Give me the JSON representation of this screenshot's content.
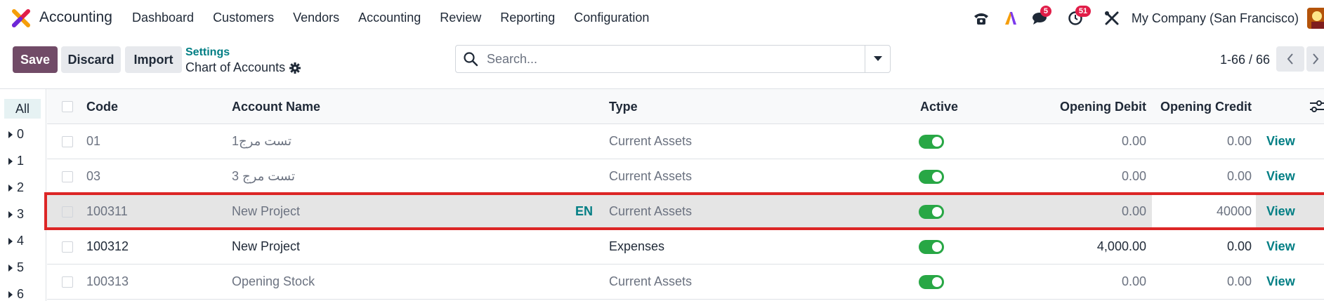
{
  "app": {
    "name": "Accounting",
    "logo_icon": "odoo-accounting-logo-icon"
  },
  "nav": {
    "items": [
      "Dashboard",
      "Customers",
      "Vendors",
      "Accounting",
      "Review",
      "Reporting",
      "Configuration"
    ]
  },
  "systray": {
    "voip_icon": "phone-icon",
    "ai_icon": "ai-icon",
    "messages_icon": "chat-icon",
    "messages_count": "5",
    "activities_icon": "clock-icon",
    "activities_count": "51",
    "debug_icon": "tools-icon",
    "company": "My Company (San Francisco)"
  },
  "control_panel": {
    "save_label": "Save",
    "discard_label": "Discard",
    "import_label": "Import",
    "breadcrumb_parent": "Settings",
    "page_title": "Chart of Accounts",
    "search_placeholder": "Search...",
    "pager_value": "1-66 / 66"
  },
  "side_panel": {
    "all_label": "All",
    "groups": [
      "0",
      "1",
      "2",
      "3",
      "4",
      "5",
      "6"
    ]
  },
  "table": {
    "columns": {
      "code": "Code",
      "name": "Account Name",
      "type": "Type",
      "active": "Active",
      "debit": "Opening Debit",
      "credit": "Opening Credit"
    },
    "rows": [
      {
        "code": "01",
        "name": "تست مرج1",
        "lang": "",
        "type": "Current Assets",
        "active": true,
        "debit": "0.00",
        "credit": "0.00",
        "action": "View",
        "muted": true
      },
      {
        "code": "03",
        "name": "تست مرج 3",
        "lang": "",
        "type": "Current Assets",
        "active": true,
        "debit": "0.00",
        "credit": "0.00",
        "action": "View",
        "muted": true
      },
      {
        "code": "100311",
        "name": "New Project",
        "lang": "EN",
        "type": "Current Assets",
        "active": true,
        "debit": "0.00",
        "credit": "40000",
        "action": "View",
        "muted": true,
        "selected": true
      },
      {
        "code": "100312",
        "name": "New Project",
        "lang": "",
        "type": "Expenses",
        "active": true,
        "debit": "4,000.00",
        "credit": "0.00",
        "action": "View",
        "muted": false
      },
      {
        "code": "100313",
        "name": "Opening Stock",
        "lang": "",
        "type": "Current Assets",
        "active": true,
        "debit": "0.00",
        "credit": "0.00",
        "action": "View",
        "muted": true
      }
    ]
  },
  "colors": {
    "primary": "#714b67",
    "link": "#017e84",
    "toggle_on": "#28a745",
    "highlight": "#dc2626",
    "badge": "#e11d48"
  }
}
